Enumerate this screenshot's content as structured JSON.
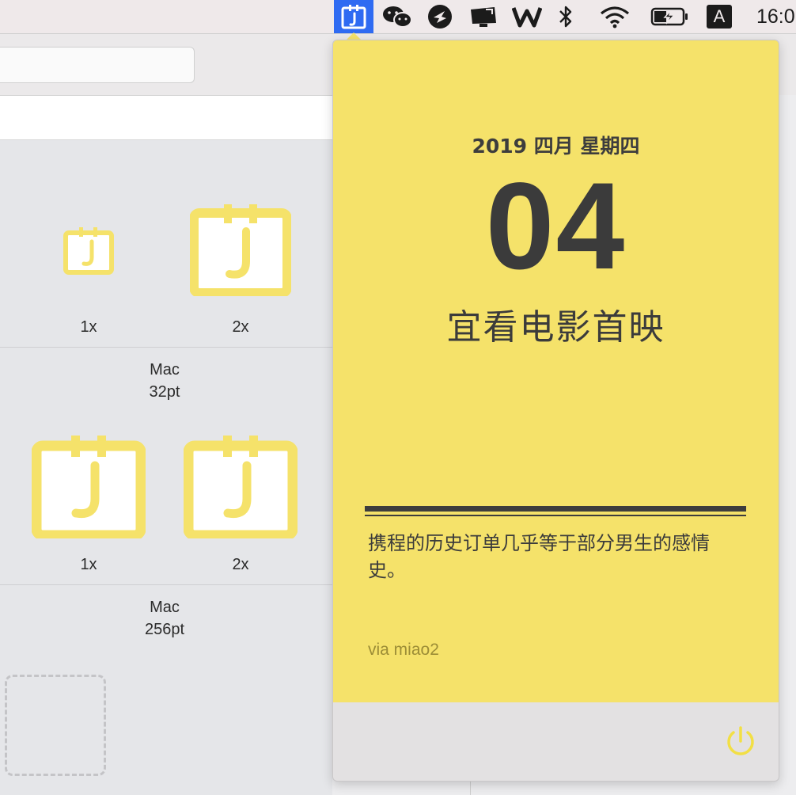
{
  "menubar": {
    "items": [
      {
        "name": "calendar-app-icon",
        "active": true
      },
      {
        "name": "wechat-icon"
      },
      {
        "name": "bird-icon"
      },
      {
        "name": "monitor-icon"
      },
      {
        "name": "vw-icon"
      },
      {
        "name": "bluetooth-icon"
      },
      {
        "name": "wifi-icon"
      },
      {
        "name": "battery-charging-icon"
      },
      {
        "name": "input-method-icon",
        "label": "A"
      }
    ],
    "clock": "16:0",
    "app_accent": "#2f6bf2"
  },
  "background_window": {
    "groups": [
      {
        "scales": [
          "1x",
          "2x"
        ],
        "platform": "Mac",
        "size": "32pt"
      },
      {
        "scales": [
          "1x",
          "2x"
        ],
        "platform": "Mac",
        "size": "256pt"
      }
    ]
  },
  "popover": {
    "date_line": "2019 四月 星期四",
    "day": "04",
    "auspice": "宜看电影首映",
    "quote": "携程的历史订单几乎等于部分男生的感情史。",
    "source": "via miao2",
    "card_color": "#f5e26a",
    "power_icon": "power-icon"
  }
}
